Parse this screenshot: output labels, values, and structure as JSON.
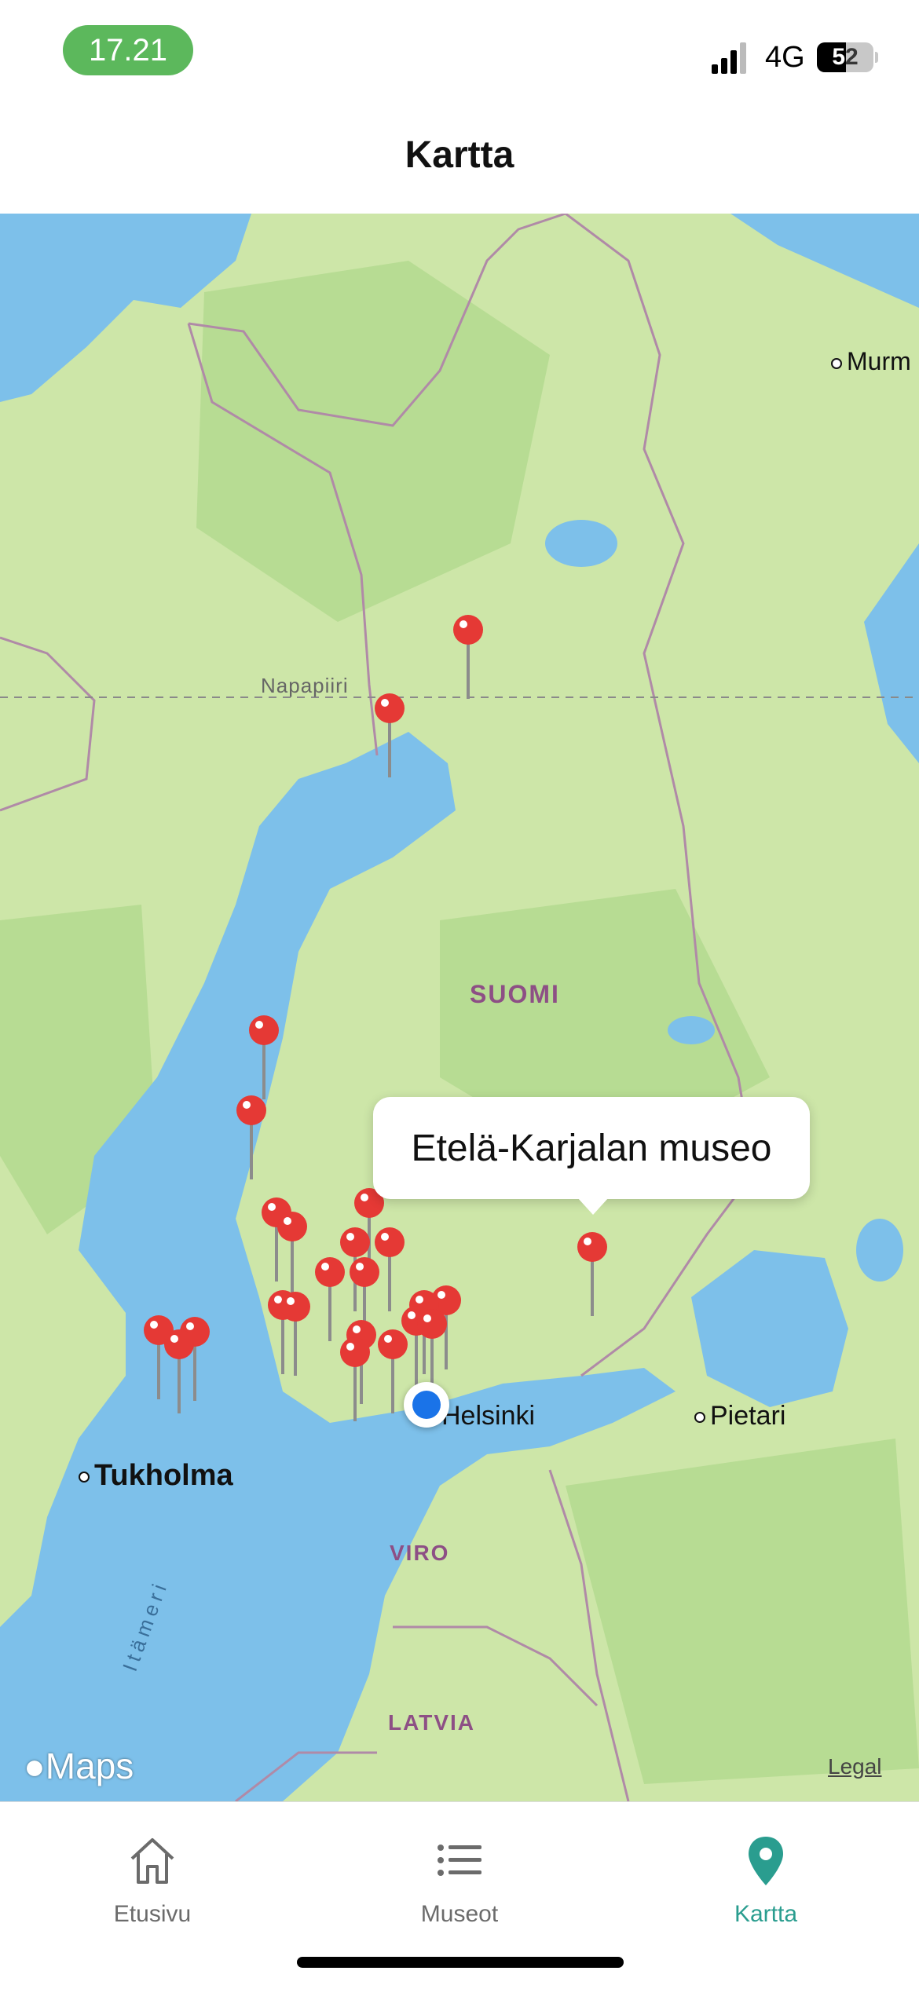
{
  "status_bar": {
    "time": "17.21",
    "network": "4G",
    "battery": "52",
    "battery_level": 0.52
  },
  "header": {
    "title": "Kartta"
  },
  "map": {
    "labels": {
      "murmansk": "Murm",
      "arctic_circle": "Napapiiri",
      "finland": "SUOMI",
      "helsinki": "Helsinki",
      "st_petersburg": "Pietari",
      "stockholm": "Tukholma",
      "estonia": "VIRO",
      "latvia": "LATVIA",
      "baltic_sea": "Itämeri"
    },
    "callout": "Etelä-Karjalan museo",
    "attribution": "Maps",
    "legal": "Legal",
    "pin_color": "#e53935"
  },
  "tabs": [
    {
      "label": "Etusivu",
      "icon": "home-icon",
      "active": false
    },
    {
      "label": "Museot",
      "icon": "list-icon",
      "active": false
    },
    {
      "label": "Kartta",
      "icon": "map-pin-icon",
      "active": true
    }
  ],
  "colors": {
    "accent": "#2a9d8f",
    "water": "#7dc0ea",
    "land": "#c9e4a6"
  }
}
